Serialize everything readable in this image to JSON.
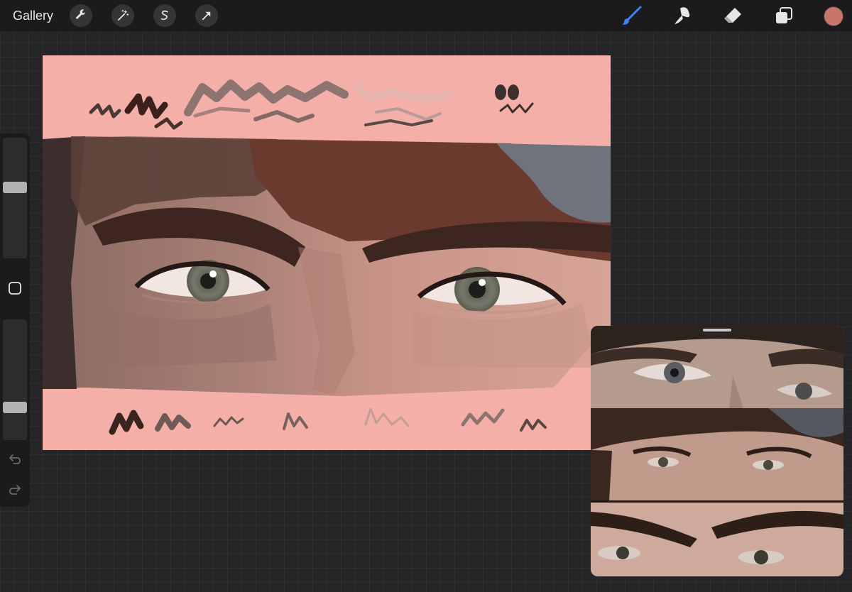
{
  "topbar": {
    "gallery_label": "Gallery",
    "left_tools": [
      "wrench-icon",
      "magic-wand-icon",
      "selection-icon",
      "transform-arrow-icon"
    ],
    "right_tools": [
      "brush-icon",
      "smudge-icon",
      "eraser-icon",
      "layers-icon"
    ],
    "active_tool": "brush",
    "current_color": "#c8766a"
  },
  "sidebar": {
    "brush_size": 0.6,
    "opacity": 0.25,
    "buttons": [
      "modify-square-icon",
      "undo-icon",
      "redo-icon"
    ]
  },
  "colors": {
    "accent": "#3b82f6",
    "canvas_background": "#f4b0a8"
  },
  "reference": {
    "visible": true,
    "photos": 3
  }
}
